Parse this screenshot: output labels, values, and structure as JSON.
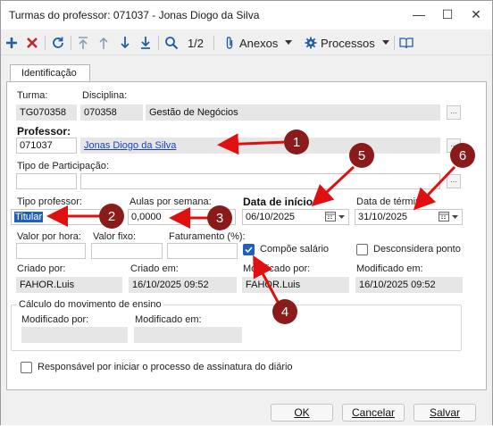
{
  "window": {
    "title": "Turmas do professor: 071037 - Jonas Diogo da Silva",
    "minimize_glyph": "—",
    "maximize_glyph": "☐",
    "close_glyph": "✕"
  },
  "toolbar": {
    "page_indicator": "1/2",
    "anexos_label": "Anexos",
    "processos_label": "Processos",
    "icons": [
      "add-icon",
      "delete-icon",
      "refresh-icon",
      "first-icon",
      "previous-icon",
      "next-icon",
      "last-icon",
      "search-icon",
      "attachment-icon",
      "gear-icon",
      "book-icon"
    ]
  },
  "tabs": [
    {
      "label": "Identificação"
    }
  ],
  "form": {
    "turma": {
      "label": "Turma:",
      "value": "TG070358"
    },
    "disciplina": {
      "label": "Disciplina:",
      "code": "070358",
      "name": "Gestão de Negócios"
    },
    "professor": {
      "label": "Professor:",
      "code": "071037",
      "name": "Jonas Diogo da Silva"
    },
    "tipo_participacao": {
      "label": "Tipo de Participação:",
      "code": "",
      "name": ""
    },
    "tipo_professor": {
      "label": "Tipo professor:",
      "value": "Titular"
    },
    "aulas_por_semana": {
      "label": "Aulas por semana:",
      "value": "0,0000"
    },
    "data_inicio": {
      "label": "Data de início",
      "value": "06/10/2025"
    },
    "data_termino": {
      "label": "Data de término",
      "value": "31/10/2025"
    },
    "valor_por_hora": {
      "label": "Valor por hora:",
      "value": ""
    },
    "valor_fixo": {
      "label": "Valor fixo:",
      "value": ""
    },
    "faturamento": {
      "label": "Faturamento (%):",
      "value": ""
    },
    "compoe_salario": {
      "label": "Compõe salário",
      "checked": true
    },
    "desconsidera_ponto": {
      "label": "Desconsidera ponto",
      "checked": false
    },
    "criado_por": {
      "label": "Criado por:",
      "value": "FAHOR.Luis"
    },
    "criado_em": {
      "label": "Criado em:",
      "value": "16/10/2025 09:52"
    },
    "modificado_por": {
      "label": "Modificado por:",
      "value": "FAHOR.Luis"
    },
    "modificado_em": {
      "label": "Modificado em:",
      "value": "16/10/2025 09:52"
    },
    "calculo": {
      "title": "Cálculo do movimento de ensino",
      "modificado_por_label": "Modificado por:",
      "modificado_por_value": "",
      "modificado_em_label": "Modificado em:",
      "modificado_em_value": ""
    },
    "responsavel": {
      "label": "Responsável por iniciar o processo de assinatura do diário",
      "checked": false
    },
    "ellipsis": "..."
  },
  "buttons": {
    "ok": "OK",
    "cancelar": "Cancelar",
    "salvar": "Salvar"
  },
  "annotations": {
    "labels": [
      "1",
      "2",
      "3",
      "4",
      "5",
      "6"
    ],
    "color": "#e01010",
    "circle_color": "#8b1a1a"
  }
}
